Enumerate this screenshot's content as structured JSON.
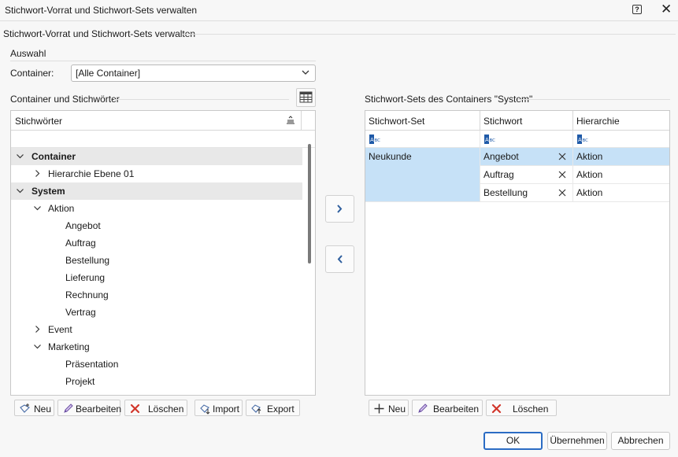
{
  "window": {
    "title": "Stichwort-Vorrat und Stichwort-Sets verwalten"
  },
  "header": {
    "title": "Stichwort-Vorrat und Stichwort-Sets verwalten"
  },
  "selection": {
    "group_label": "Auswahl",
    "container_label": "Container:",
    "container_value": "[Alle Container]"
  },
  "tree": {
    "section_title": "Container und Stichwörter",
    "column_header": "Stichwörter",
    "rows": [
      {
        "label": "Container",
        "level": 0,
        "group": true,
        "expanded": true
      },
      {
        "label": "Hierarchie Ebene 01",
        "level": 1,
        "group": false,
        "expanded": false
      },
      {
        "label": "System",
        "level": 0,
        "group": true,
        "expanded": true
      },
      {
        "label": "Aktion",
        "level": 1,
        "group": false,
        "expanded": true
      },
      {
        "label": "Angebot",
        "level": 2,
        "group": false,
        "leaf": true
      },
      {
        "label": "Auftrag",
        "level": 2,
        "group": false,
        "leaf": true
      },
      {
        "label": "Bestellung",
        "level": 2,
        "group": false,
        "leaf": true
      },
      {
        "label": "Lieferung",
        "level": 2,
        "group": false,
        "leaf": true
      },
      {
        "label": "Rechnung",
        "level": 2,
        "group": false,
        "leaf": true
      },
      {
        "label": "Vertrag",
        "level": 2,
        "group": false,
        "leaf": true
      },
      {
        "label": "Event",
        "level": 1,
        "group": false,
        "expanded": false
      },
      {
        "label": "Marketing",
        "level": 1,
        "group": false,
        "expanded": true
      },
      {
        "label": "Präsentation",
        "level": 2,
        "group": false,
        "leaf": true
      },
      {
        "label": "Projekt",
        "level": 2,
        "group": false,
        "leaf": true
      }
    ],
    "toolbar": {
      "new": "Neu",
      "edit": "Bearbeiten",
      "delete": "Löschen",
      "import": "Import",
      "export": "Export"
    }
  },
  "sets": {
    "section_title": "Stichwort-Sets des Containers \"System\"",
    "columns": [
      "Stichwort-Set",
      "Stichwort",
      "Hierarchie"
    ],
    "set_name": "Neukunde",
    "rows": [
      {
        "stichwort": "Angebot",
        "hierarchie": "Aktion"
      },
      {
        "stichwort": "Auftrag",
        "hierarchie": "Aktion"
      },
      {
        "stichwort": "Bestellung",
        "hierarchie": "Aktion"
      }
    ],
    "toolbar": {
      "new": "Neu",
      "edit": "Bearbeiten",
      "delete": "Löschen"
    }
  },
  "dialog": {
    "ok": "OK",
    "apply": "Übernehmen",
    "cancel": "Abbrechen"
  },
  "colors": {
    "selection": "#c6e1f7",
    "accent": "#2b6cc4",
    "delete_red": "#d2362b"
  }
}
